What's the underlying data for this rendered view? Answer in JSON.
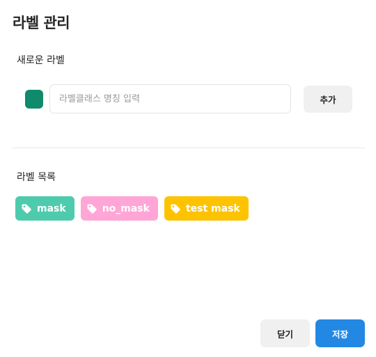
{
  "dialog": {
    "title": "라벨 관리"
  },
  "new_label": {
    "section_title": "새로운 라벨",
    "color": "#0f8a6a",
    "input_placeholder": "라벨클래스 명칭 입력",
    "input_value": "",
    "add_button": "추가"
  },
  "label_list": {
    "section_title": "라벨 목록",
    "items": [
      {
        "name": "mask",
        "color": "#4ecbad",
        "icon": "tag-icon"
      },
      {
        "name": "no_mask",
        "color": "#ffa6d6",
        "icon": "tag-icon"
      },
      {
        "name": "test mask",
        "color": "#fec300",
        "icon": "tag-icon"
      }
    ]
  },
  "footer": {
    "close_button": "닫기",
    "save_button": "저장",
    "save_color": "#2388e4"
  }
}
